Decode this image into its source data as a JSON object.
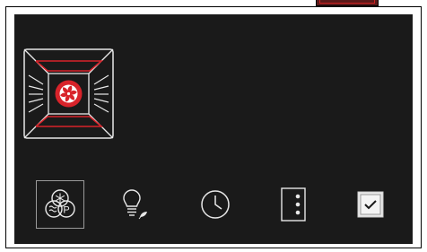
{
  "screen": {
    "title": "",
    "colors": {
      "background": "#1a1a1a",
      "accent_red": "#d8232a",
      "icon_white": "#e8e8e8",
      "selection_border": "#9a9a9a"
    }
  },
  "oven_mode_icon": {
    "icon": "convection-fan-icon",
    "selected": true
  },
  "bottom_toolbar": {
    "items": [
      {
        "name": "defrost-proof-icon",
        "selected": true
      },
      {
        "name": "light-eco-icon",
        "selected": false
      },
      {
        "name": "timer-clock-icon",
        "selected": false
      },
      {
        "name": "more-options-icon",
        "selected": false
      },
      {
        "name": "checkbox-confirm-icon",
        "selected": false
      }
    ]
  }
}
